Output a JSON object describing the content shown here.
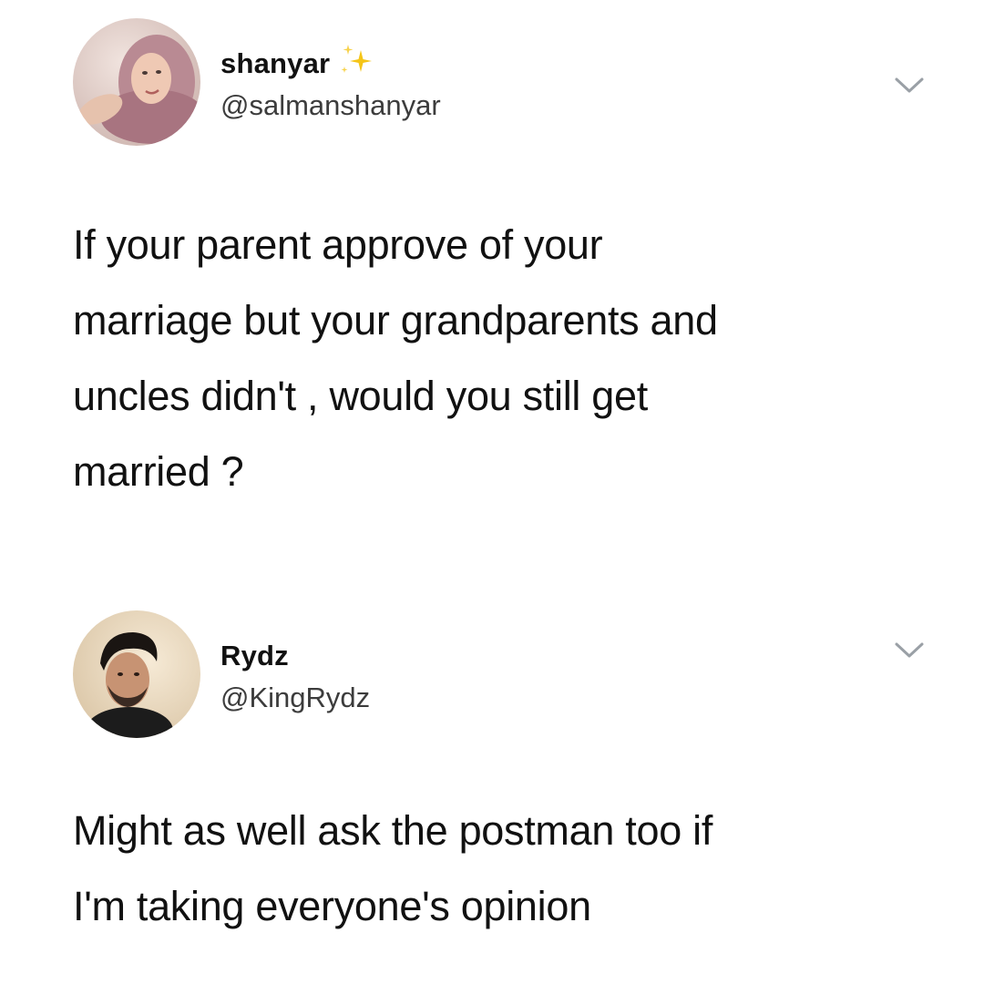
{
  "tweets": [
    {
      "display_name": "shanyar",
      "badge_icon": "sparkle-icon",
      "handle": "@salmanshanyar",
      "avatar_icon": "profile-photo",
      "menu_icon": "chevron-down-icon",
      "text_lines": [
        "If your parent approve of your",
        "marriage but your grandparents and",
        "uncles didn't , would you still get",
        "married ?"
      ]
    },
    {
      "display_name": "Rydz",
      "handle": "@KingRydz",
      "avatar_icon": "profile-photo",
      "menu_icon": "chevron-down-icon",
      "text_lines": [
        "Might as well ask the postman too if",
        "I'm taking everyone's opinion"
      ]
    }
  ],
  "colors": {
    "background": "#ffffff",
    "text": "#111111",
    "handle": "#3c3c3c",
    "chevron": "#9aa0a6",
    "sparkle": "#f5c518"
  }
}
